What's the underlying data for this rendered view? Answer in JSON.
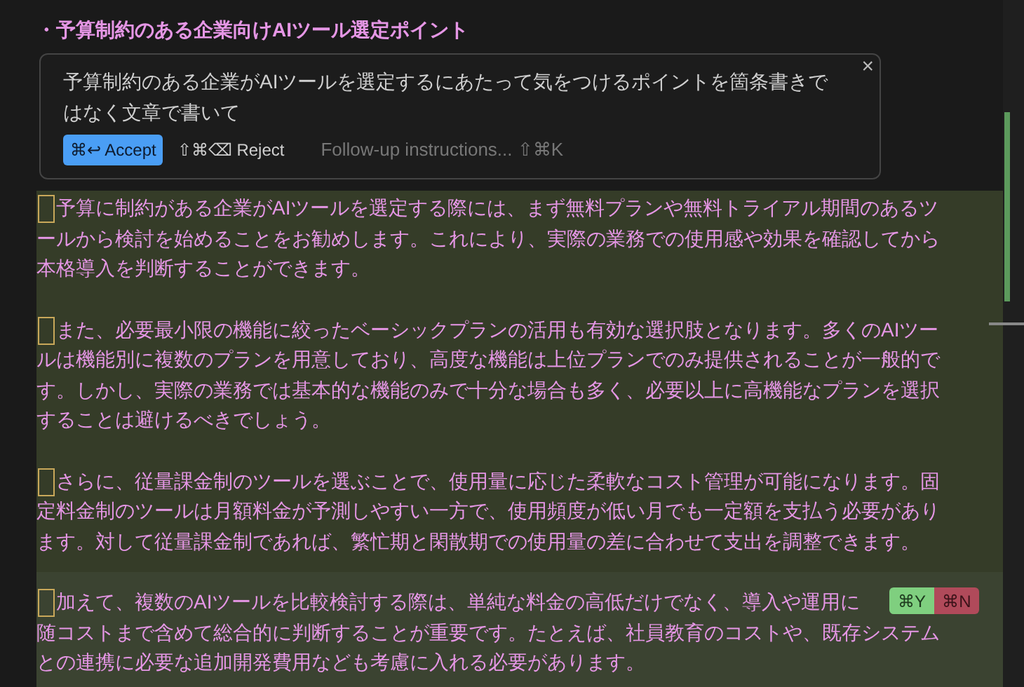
{
  "heading": "・予算制約のある企業向けAIツール選定ポイント",
  "prompt": {
    "text": "予算制約のある企業がAIツールを選定するにあたって気をつけるポイントを箇条書きではなく文章で書いて",
    "close": "×",
    "accept": "⌘↩ Accept",
    "reject": "⇧⌘⌫ Reject",
    "followup_placeholder": "Follow-up instructions... ⇧⌘K"
  },
  "paragraphs": [
    {
      "active": false,
      "lines": [
        "予算に制約がある企業がAIツールを選定する際には、まず無料プランや無料トライアル期間のあるツ",
        "ールから検討を始めることをお勧めします。これにより、実際の業務での使用感や効果を確認してから",
        "本格導入を判断することができます。"
      ]
    },
    {
      "active": false,
      "lines": [
        "また、必要最小限の機能に絞ったベーシックプランの活用も有効な選択肢となります。多くのAIツー",
        "ルは機能別に複数のプランを用意しており、高度な機能は上位プランでのみ提供されることが一般的で",
        "す。しかし、実際の業務では基本的な機能のみで十分な場合も多く、必要以上に高機能なプランを選択",
        "することは避けるべきでしょう。"
      ]
    },
    {
      "active": false,
      "lines": [
        "さらに、従量課金制のツールを選ぶことで、使用量に応じた柔軟なコスト管理が可能になります。固",
        "定料金制のツールは月額料金が予測しやすい一方で、使用頻度が低い月でも一定額を支払う必要があり",
        "ます。対して従量課金制であれば、繁忙期と閑散期での使用量の差に合わせて支出を調整できます。"
      ]
    },
    {
      "active": true,
      "lines": [
        "加えて、複数のAIツールを比較検討する際は、単純な料金の高低だけでなく、導入や運用に",
        "随コストまで含めて総合的に判断することが重要です。たとえば、社員教育のコストや、既存システム",
        "との連携に必要な追加開発費用なども考慮に入れる必要があります。"
      ]
    }
  ],
  "inline_actions": [
    {
      "kind": "accept",
      "label": "⌘Y"
    },
    {
      "kind": "reject",
      "label": "⌘N"
    }
  ]
}
